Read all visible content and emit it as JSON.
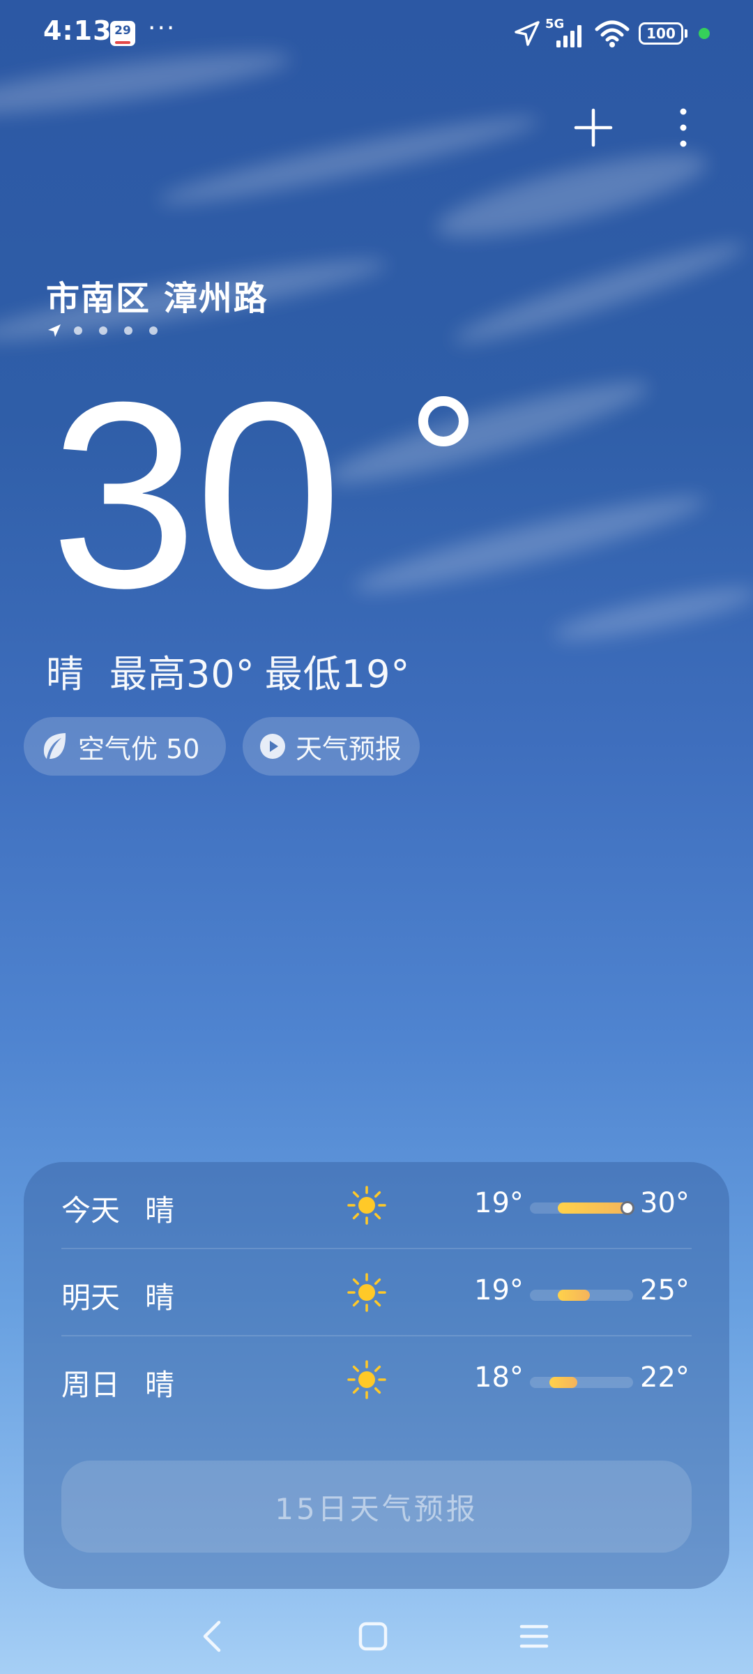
{
  "status_bar": {
    "time": "4:13",
    "calendar_day": "29",
    "more": "···",
    "network": "5G",
    "battery": "100"
  },
  "location": {
    "name": "市南区 漳州路",
    "page_count": 5,
    "current_page": 1
  },
  "current": {
    "temperature": "30",
    "condition": "晴",
    "high": "最高30°",
    "low": "最低19°"
  },
  "chips": {
    "air_quality": "空气优 50",
    "forecast_video": "天气预报"
  },
  "forecast": {
    "range_min": 18,
    "range_max": 30,
    "rows": [
      {
        "day": "今天",
        "condition": "晴",
        "icon": "sun-icon",
        "low": "19°",
        "high": "30°",
        "low_value": 19,
        "high_value": 30,
        "current_value": 30
      },
      {
        "day": "明天",
        "condition": "晴",
        "icon": "sun-icon",
        "low": "19°",
        "high": "25°",
        "low_value": 19,
        "high_value": 25
      },
      {
        "day": "周日",
        "condition": "晴",
        "icon": "sun-icon",
        "low": "18°",
        "high": "22°",
        "low_value": 18,
        "high_value": 22
      }
    ],
    "more_button": "15日天气预报"
  },
  "colors": {
    "range_fill": "#ffd24a",
    "status_dot": "#35d05a"
  }
}
